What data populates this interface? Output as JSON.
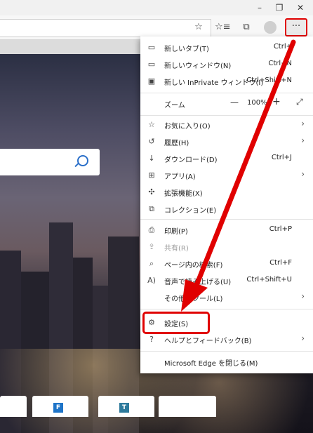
{
  "window": {
    "minimize": "–",
    "restore": "❐",
    "close": "✕"
  },
  "toolbar": {
    "more_label": "···"
  },
  "tiles": [
    "F",
    "T"
  ],
  "colors": {
    "annotation_red": "#e00000",
    "accent_blue": "#2a6fc9",
    "tile_blue": "#1e74c8"
  },
  "menu": {
    "items": [
      {
        "icon": "new-tab-icon",
        "label": "新しいタブ(T)",
        "shortcut": "Ctrl+"
      },
      {
        "icon": "new-window-icon",
        "label": "新しいウィンドウ(N)",
        "shortcut": "Ctrl+N"
      },
      {
        "icon": "inprivate-icon",
        "label": "新しい InPrivate ウィンドウ(I)",
        "shortcut": "Ctrl+Shift+N"
      }
    ],
    "zoom": {
      "label": "ズーム",
      "minus": "—",
      "value": "100%",
      "plus": "+",
      "fullscreen": "⤢"
    },
    "items2": [
      {
        "icon": "favorites-icon",
        "label": "お気に入り(O)",
        "chevron": "›"
      },
      {
        "icon": "history-icon",
        "label": "履歴(H)",
        "chevron": "›"
      },
      {
        "icon": "download-icon",
        "label": "ダウンロード(D)",
        "shortcut": "Ctrl+J"
      },
      {
        "icon": "apps-icon",
        "label": "アプリ(A)",
        "chevron": "›"
      },
      {
        "icon": "extensions-icon",
        "label": "拡張機能(X)"
      },
      {
        "icon": "collections-icon",
        "label": "コレクション(E)"
      }
    ],
    "items3": [
      {
        "icon": "print-icon",
        "label": "印刷(P)",
        "shortcut": "Ctrl+P"
      },
      {
        "icon": "share-icon",
        "label": "共有(R)"
      },
      {
        "icon": "find-icon",
        "label": "ページ内の検索(F)",
        "shortcut": "Ctrl+F"
      },
      {
        "icon": "read-aloud-icon",
        "label": "音声で読み上げる(U)",
        "shortcut": "Ctrl+Shift+U"
      },
      {
        "icon": "more-tools-icon",
        "label": "その他のツール(L)",
        "chevron": "›"
      }
    ],
    "items4": [
      {
        "icon": "settings-icon",
        "label": "設定(S)"
      },
      {
        "icon": "help-icon",
        "label": "ヘルプとフィードバック(B)",
        "chevron": "›"
      }
    ],
    "close": "Microsoft Edge を閉じる(M)"
  }
}
